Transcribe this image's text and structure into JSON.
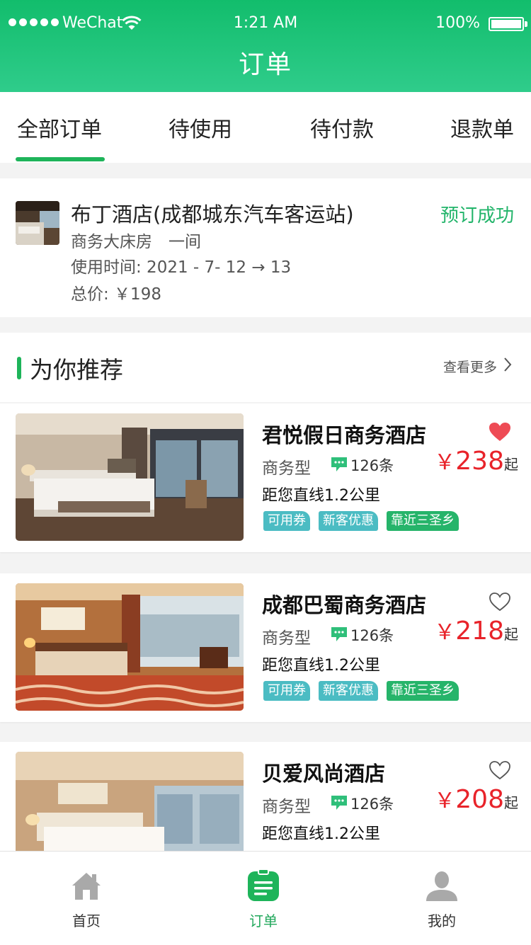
{
  "status_bar": {
    "carrier": "WeChat",
    "time": "1:21 AM",
    "battery": "100%"
  },
  "header": {
    "title": "订单"
  },
  "tabs": [
    {
      "label": "全部订单",
      "active": true
    },
    {
      "label": "待使用",
      "active": false
    },
    {
      "label": "待付款",
      "active": false
    },
    {
      "label": "退款单",
      "active": false
    }
  ],
  "order": {
    "hotel": "布丁酒店(成都城东汽车客运站)",
    "status": "预订成功",
    "room": "商务大床房　一间",
    "use_time": "使用时间: 2021 - 7- 12 → 13",
    "total": "总价: ￥198"
  },
  "recommend": {
    "title": "为你推荐",
    "more": "查看更多",
    "items": [
      {
        "name": "君悦假日商务酒店",
        "favorited": true,
        "type": "商务型",
        "comments": "126条",
        "price_currency": "￥",
        "price": "238",
        "price_suffix": "起",
        "distance": "距您直线1.2公里",
        "tags": [
          "可用券",
          "新客优惠",
          "靠近三圣乡"
        ]
      },
      {
        "name": "成都巴蜀商务酒店",
        "favorited": false,
        "type": "商务型",
        "comments": "126条",
        "price_currency": "￥",
        "price": "218",
        "price_suffix": "起",
        "distance": "距您直线1.2公里",
        "tags": [
          "可用券",
          "新客优惠",
          "靠近三圣乡"
        ]
      },
      {
        "name": "贝爱风尚酒店",
        "favorited": false,
        "type": "商务型",
        "comments": "126条",
        "price_currency": "￥",
        "price": "208",
        "price_suffix": "起",
        "distance": "距您直线1.2公里",
        "tags": []
      }
    ]
  },
  "tabbar": [
    {
      "label": "首页",
      "icon": "home-icon",
      "active": false
    },
    {
      "label": "订单",
      "icon": "order-list-icon",
      "active": true
    },
    {
      "label": "我的",
      "icon": "user-icon",
      "active": false
    }
  ],
  "colors": {
    "brand_green": "#1eb45a",
    "price_red": "#e8232a",
    "heart_active": "#ee4b55"
  }
}
